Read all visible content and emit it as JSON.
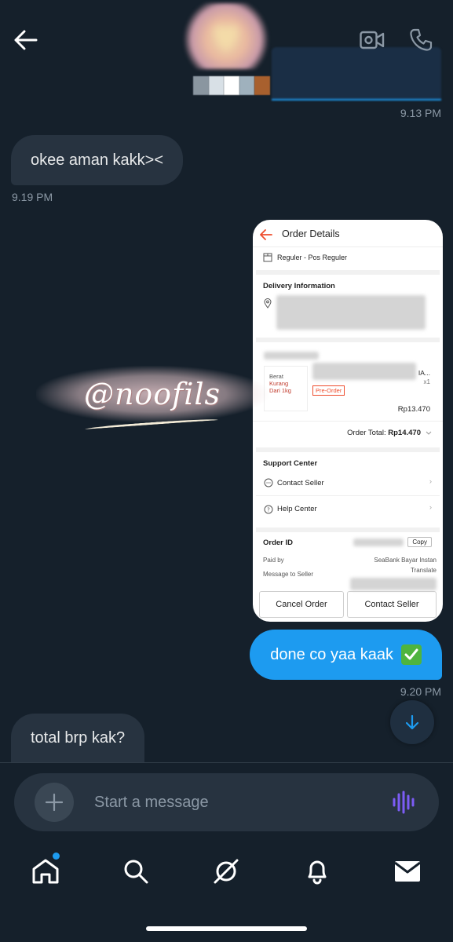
{
  "conversation": {
    "messages": [
      {
        "direction": "out",
        "kind": "media",
        "time": "9.13 PM"
      },
      {
        "direction": "in",
        "text": "okee aman kakk><",
        "time": "9.19 PM"
      },
      {
        "direction": "out",
        "kind": "screenshot"
      },
      {
        "direction": "out",
        "text": "done co yaa kaak",
        "time": "9.20 PM"
      },
      {
        "direction": "in",
        "text": "total brp kak?"
      }
    ]
  },
  "order_screenshot": {
    "title": "Order Details",
    "shipping": "Reguler - Pos Reguler",
    "delivery_heading": "Delivery Information",
    "product_tag": "Pre-Order",
    "product_image_lines": [
      "Berat",
      "Kurang",
      "Dari 1kg"
    ],
    "product_label_suffix": "IA...",
    "qty": "x1",
    "price": "Rp13.470",
    "order_total_label": "Order Total:",
    "order_total_value": "Rp14.470",
    "support_heading": "Support Center",
    "contact_seller_row": "Contact Seller",
    "help_center_row": "Help Center",
    "order_id_label": "Order ID",
    "copy_label": "Copy",
    "paid_by_label": "Paid by",
    "paid_by_value": "SeaBank Bayar Instan",
    "message_label": "Message to Seller",
    "translate_label": "Translate",
    "cancel_button": "Cancel Order",
    "contact_button": "Contact Seller"
  },
  "watermark": "@noofils",
  "composer": {
    "placeholder": "Start a message"
  },
  "nav": {
    "items": [
      "home-icon",
      "search-icon",
      "spaces-icon",
      "notifications-icon",
      "messages-icon"
    ]
  },
  "colors": {
    "background": "#15202b",
    "bubble_out": "#1d9bf0",
    "bubble_in": "#273340",
    "accent": "#1d9bf0",
    "voice": "#7c5cf5"
  }
}
